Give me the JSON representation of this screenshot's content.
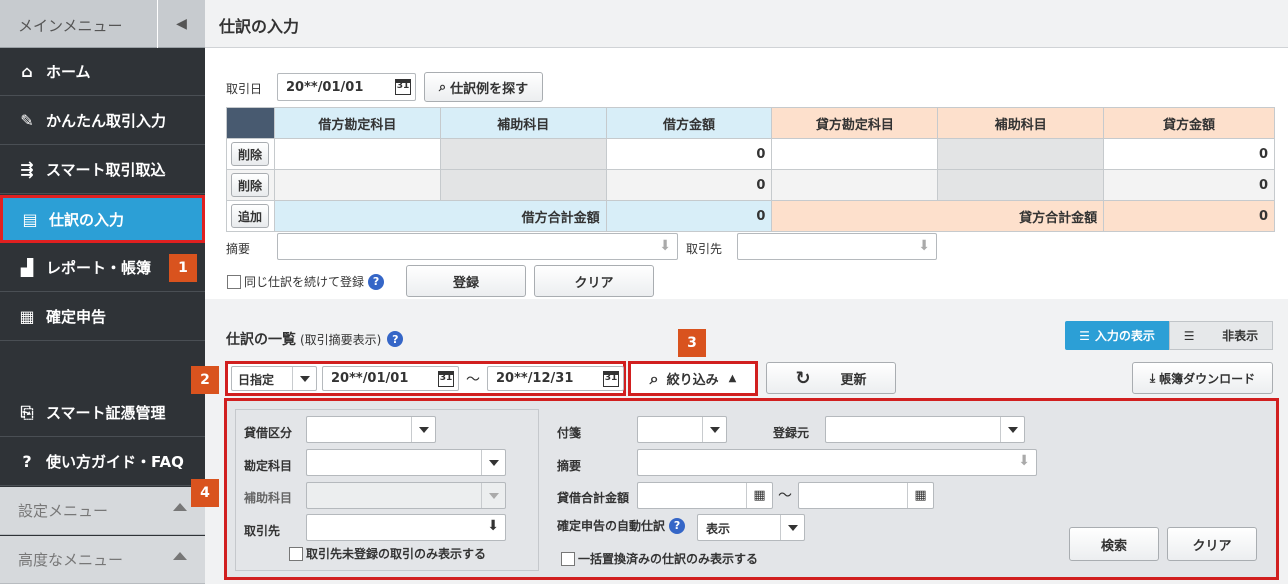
{
  "sidebar": {
    "header": "メインメニュー",
    "items": [
      {
        "label": "ホーム",
        "icon": "home-icon"
      },
      {
        "label": "かんたん取引入力",
        "icon": "pencil-icon"
      },
      {
        "label": "スマート取引取込",
        "icon": "import-icon"
      },
      {
        "label": "仕訳の入力",
        "icon": "journal-icon"
      },
      {
        "label": "レポート・帳簿",
        "icon": "chart-icon"
      },
      {
        "label": "確定申告",
        "icon": "calculator-icon"
      }
    ],
    "lower_items": [
      {
        "label": "スマート証憑管理",
        "icon": "document-icon"
      },
      {
        "label": "使い方ガイド・FAQ",
        "icon": "help-icon"
      }
    ],
    "settings_menu": "設定メニュー",
    "advanced_menu": "高度なメニュー"
  },
  "badges": {
    "b1": "1",
    "b2": "2",
    "b3": "3",
    "b4": "4"
  },
  "page": {
    "title": "仕訳の入力"
  },
  "entry": {
    "date_label": "取引日",
    "date_value": "20**/01/01",
    "search_example_button": "仕訳例を探す",
    "headers": [
      "借方勘定科目",
      "補助科目",
      "借方金額",
      "貸方勘定科目",
      "補助科目",
      "貸方金額"
    ],
    "rows": [
      {
        "action": "削除",
        "debit_amount": "0",
        "credit_amount": "0"
      },
      {
        "action": "削除",
        "debit_amount": "0",
        "credit_amount": "0"
      }
    ],
    "add_button": "追加",
    "debit_total_label": "借方合計金額",
    "debit_total": "0",
    "credit_total_label": "貸方合計金額",
    "credit_total": "0",
    "memo_label": "摘要",
    "partner_label": "取引先",
    "continue_label": "同じ仕訳を続けて登録",
    "register_button": "登録",
    "clear_button": "クリア"
  },
  "list": {
    "title": "仕訳の一覧",
    "subtitle": "(取引摘要表示)",
    "show_input": "入力の表示",
    "hide": "非表示",
    "date_mode": "日指定",
    "date_from": "20**/01/01",
    "tilde": "～",
    "date_to": "20**/12/31",
    "filter_button": "絞り込み",
    "refresh_button": "更新",
    "download_button": "帳簿ダウンロード"
  },
  "filter": {
    "debit_credit_label": "貸借区分",
    "account_label": "勘定科目",
    "sub_account_label": "補助科目",
    "partner_label": "取引先",
    "unregistered_partner_label": "取引先未登録の取引のみ表示する",
    "tag_label": "付箋",
    "source_label": "登録元",
    "memo_label": "摘要",
    "total_amount_label": "貸借合計金額",
    "tilde": "～",
    "auto_journal_label": "確定申告の自動仕訳",
    "auto_journal_value": "表示",
    "bulk_replaced_label": "一括置換済みの仕訳のみ表示する",
    "search_button": "検索",
    "clear_button": "クリア"
  }
}
